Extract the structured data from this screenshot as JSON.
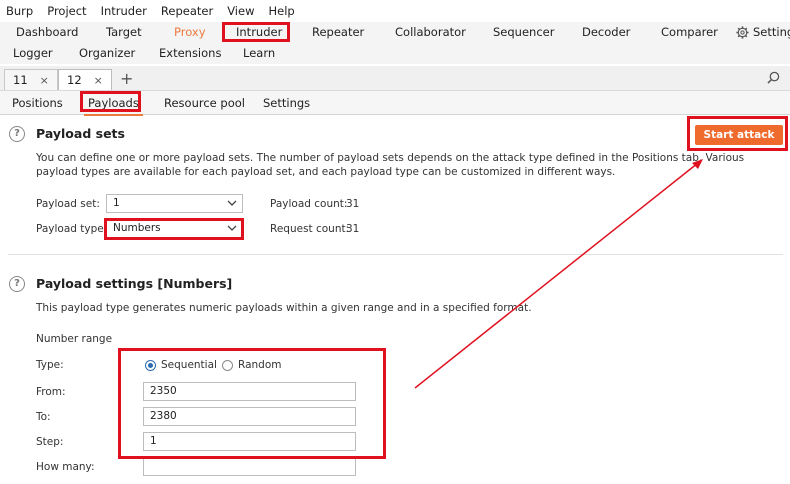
{
  "menubar": [
    "Burp",
    "Project",
    "Intruder",
    "Repeater",
    "View",
    "Help"
  ],
  "toolrow1": [
    "Dashboard",
    "Target",
    "Proxy",
    "Intruder",
    "Repeater",
    "Collaborator",
    "Sequencer",
    "Decoder",
    "Comparer",
    "Settings"
  ],
  "toolrow2": [
    "Logger",
    "Organizer",
    "Extensions",
    "Learn"
  ],
  "request_tabs": [
    {
      "label": "11",
      "close": "×"
    },
    {
      "label": "12",
      "close": "×"
    }
  ],
  "add_tab": "+",
  "subtabs": [
    "Positions",
    "Payloads",
    "Resource pool",
    "Settings"
  ],
  "payload_sets": {
    "title": "Payload sets",
    "description": "You can define one or more payload sets. The number of payload sets depends on the attack type defined in the Positions tab. Various payload types are available for each payload set, and each payload type can be customized in different ways.",
    "payload_set_label": "Payload set:",
    "payload_set_value": "1",
    "payload_type_label": "Payload type:",
    "payload_type_value": "Numbers",
    "payload_count_label": "Payload count:",
    "payload_count_value": "31",
    "request_count_label": "Request count:",
    "request_count_value": "31"
  },
  "start_attack": "Start attack",
  "payload_settings": {
    "title": "Payload settings [Numbers]",
    "description": "This payload type generates numeric payloads within a given range and in a specified format.",
    "number_range": "Number range",
    "type_label": "Type:",
    "sequential": "Sequential",
    "random": "Random",
    "from_label": "From:",
    "from_value": "2350",
    "to_label": "To:",
    "to_value": "2380",
    "step_label": "Step:",
    "step_value": "1",
    "how_many_label": "How many:",
    "how_many_value": ""
  },
  "colors": {
    "accent": "#ec7a3d",
    "button": "#ef6a2d",
    "annotation": "#e0111f"
  }
}
